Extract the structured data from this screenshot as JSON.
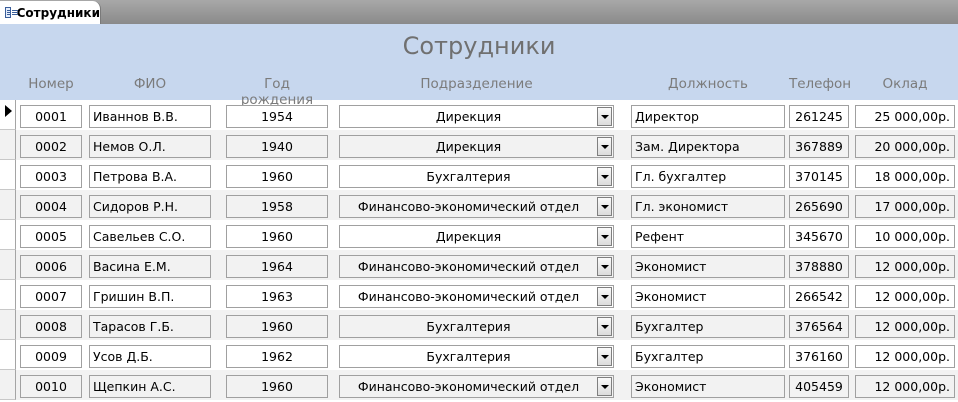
{
  "tab": {
    "label": "Сотрудники"
  },
  "form": {
    "title": "Сотрудники",
    "columns": {
      "number": "Номер",
      "fio": "ФИО",
      "birth_year": "Год рождения",
      "department": "Подразделение",
      "position": "Должность",
      "phone": "Телефон",
      "salary": "Оклад"
    }
  },
  "rows": [
    {
      "number": "0001",
      "fio": "Иваннов В.В.",
      "birth_year": "1954",
      "department": "Дирекция",
      "position": "Директор",
      "phone": "261245",
      "salary": "25 000,00р."
    },
    {
      "number": "0002",
      "fio": "Немов О.Л.",
      "birth_year": "1940",
      "department": "Дирекция",
      "position": "Зам. Директора",
      "phone": "367889",
      "salary": "20 000,00р."
    },
    {
      "number": "0003",
      "fio": "Петрова В.А.",
      "birth_year": "1960",
      "department": "Бухгалтерия",
      "position": "Гл. бухгалтер",
      "phone": "370145",
      "salary": "18 000,00р."
    },
    {
      "number": "0004",
      "fio": "Сидоров Р.Н.",
      "birth_year": "1958",
      "department": "Финансово-экономический отдел",
      "position": "Гл. экономист",
      "phone": "265690",
      "salary": "17 000,00р."
    },
    {
      "number": "0005",
      "fio": "Савельев С.О.",
      "birth_year": "1960",
      "department": "Дирекция",
      "position": "Рефент",
      "phone": "345670",
      "salary": "10 000,00р."
    },
    {
      "number": "0006",
      "fio": "Васина Е.М.",
      "birth_year": "1964",
      "department": "Финансово-экономический отдел",
      "position": "Экономист",
      "phone": "378880",
      "salary": "12 000,00р."
    },
    {
      "number": "0007",
      "fio": "Гришин В.П.",
      "birth_year": "1963",
      "department": "Финансово-экономический отдел",
      "position": "Экономист",
      "phone": "266542",
      "salary": "12 000,00р."
    },
    {
      "number": "0008",
      "fio": "Тарасов Г.Б.",
      "birth_year": "1960",
      "department": "Бухгалтерия",
      "position": "Бухгалтер",
      "phone": "376564",
      "salary": "12 000,00р."
    },
    {
      "number": "0009",
      "fio": "Усов Д.Б.",
      "birth_year": "1962",
      "department": "Бухгалтерия",
      "position": "Бухгалтер",
      "phone": "376160",
      "salary": "12 000,00р."
    },
    {
      "number": "0010",
      "fio": "Щепкин А.С.",
      "birth_year": "1960",
      "department": "Финансово-экономический отдел",
      "position": "Экономист",
      "phone": "405459",
      "salary": "12 000,00р."
    }
  ],
  "current_record_index": 0,
  "colors": {
    "header_bg": "#c7d7ee",
    "alt_row_bg": "#f2f2f2",
    "label_text": "#7b7b7b"
  }
}
